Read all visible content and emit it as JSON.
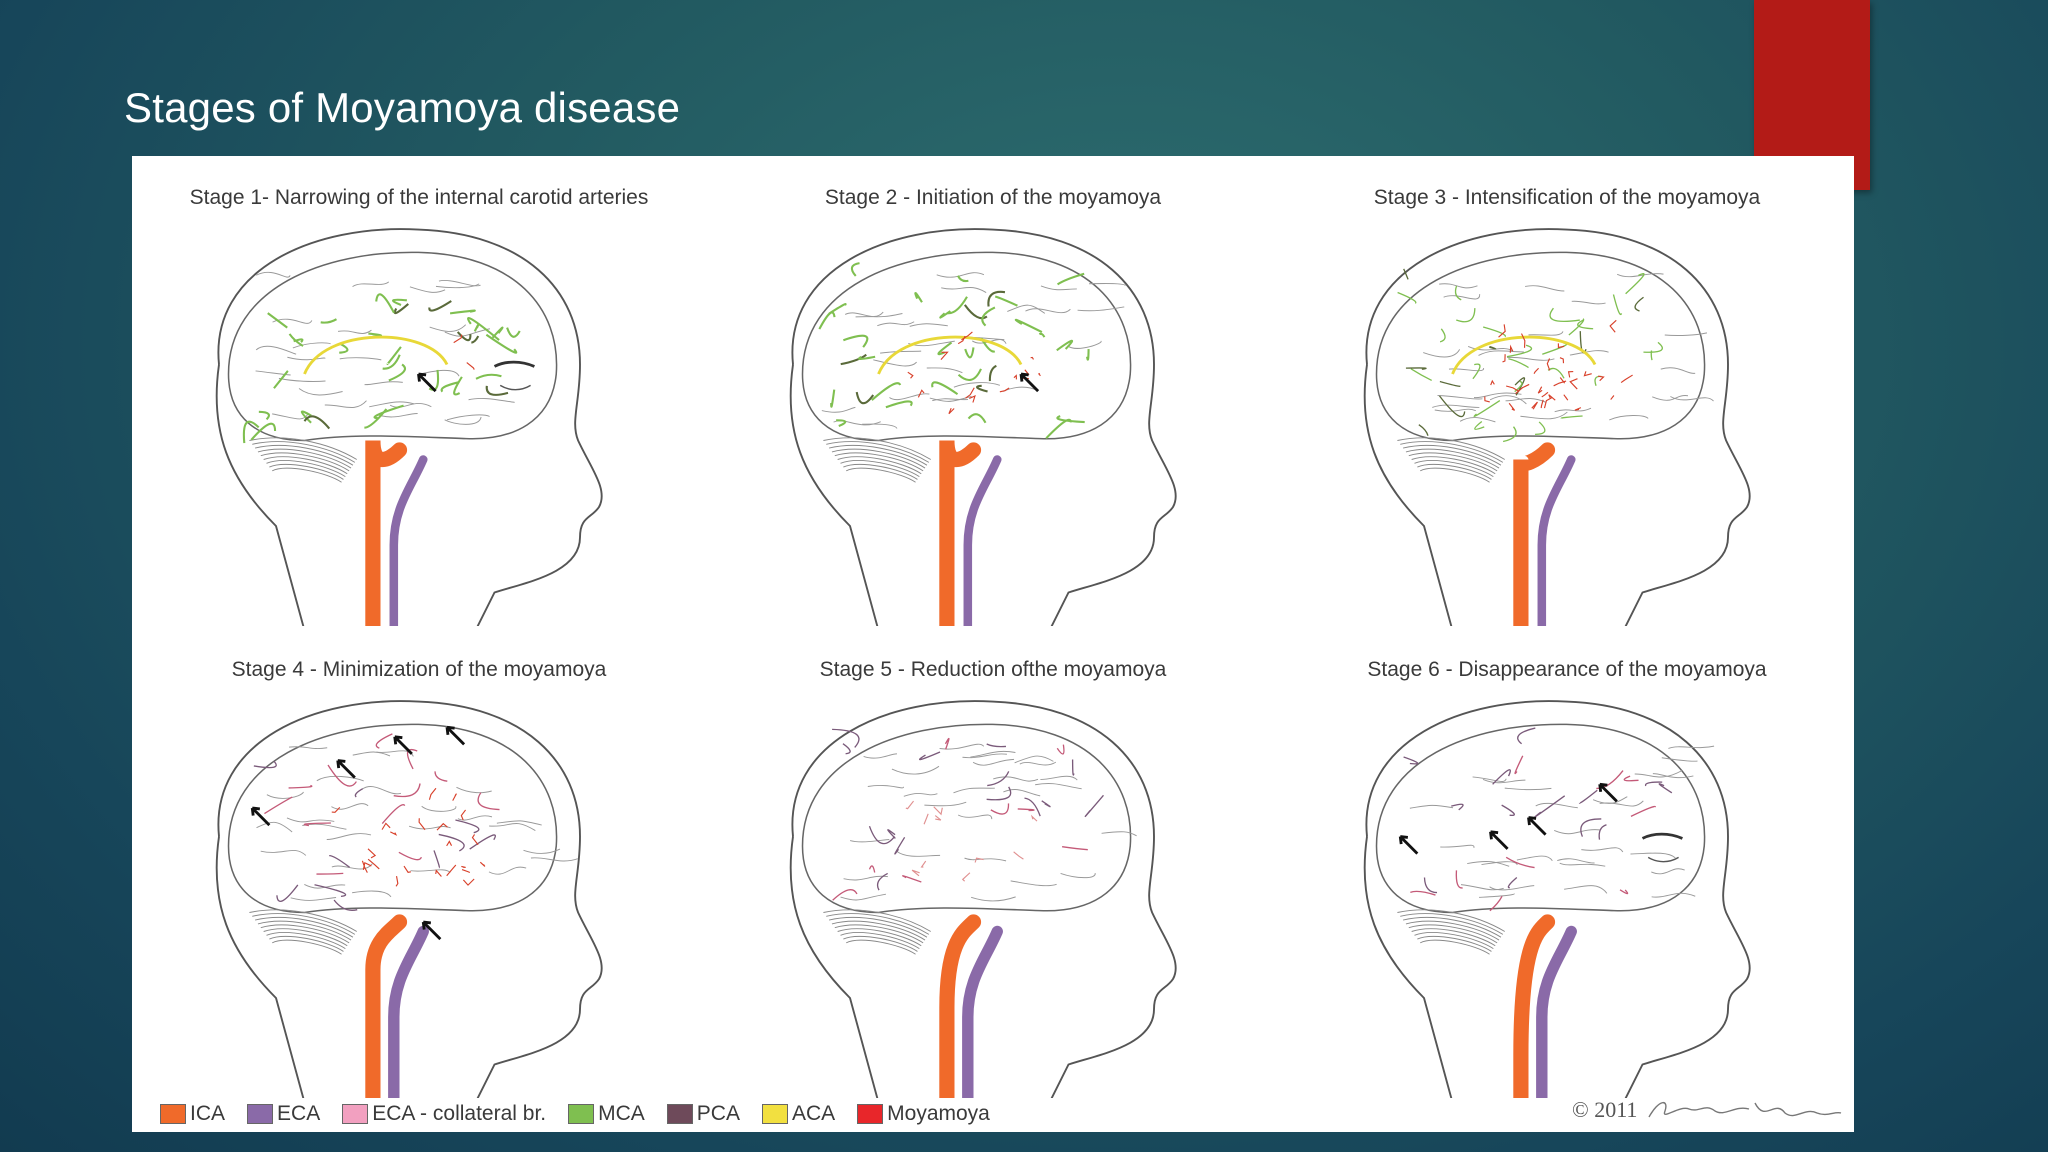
{
  "slide": {
    "title": "Stages of Moyamoya disease"
  },
  "panels": [
    {
      "title": "Stage 1- Narrowing of the internal carotid arteries",
      "stage": 1
    },
    {
      "title": "Stage 2 - Initiation of the moyamoya",
      "stage": 2
    },
    {
      "title": "Stage 3 - Intensification of the moyamoya",
      "stage": 3
    },
    {
      "title": "Stage 4 - Minimization of the moyamoya",
      "stage": 4
    },
    {
      "title": "Stage 5 - Reduction ofthe moyamoya",
      "stage": 5
    },
    {
      "title": "Stage 6 - Disappearance of the moyamoya",
      "stage": 6
    }
  ],
  "legend": [
    {
      "label": "ICA",
      "color": "#f06a2a"
    },
    {
      "label": "ECA",
      "color": "#8a6aa8"
    },
    {
      "label": "ECA - collateral br.",
      "color": "#f2a0c0"
    },
    {
      "label": "MCA",
      "color": "#7fbf50"
    },
    {
      "label": "PCA",
      "color": "#6e4a5a"
    },
    {
      "label": "ACA",
      "color": "#f2e040"
    },
    {
      "label": "Moyamoya",
      "color": "#e8262a"
    }
  ],
  "copyright": "© 2011",
  "colors": {
    "background": "#1f5560",
    "accent": "#b31b17",
    "ica": "#f06a2a",
    "eca": "#8a6aa8",
    "mca": "#7fbf50",
    "aca": "#e8d838",
    "moyamoya": "#d8402a",
    "outline": "#555555"
  }
}
